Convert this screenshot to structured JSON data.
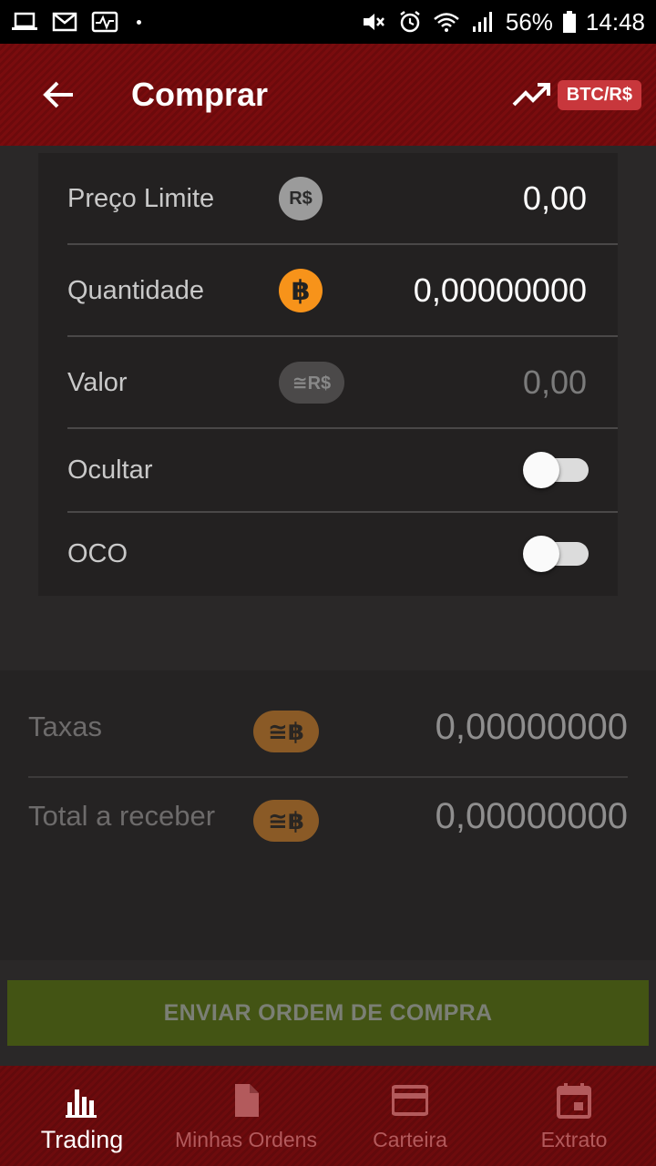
{
  "status_bar": {
    "battery": "56%",
    "time": "14:48"
  },
  "header": {
    "title": "Comprar",
    "pair": "BTC/R$"
  },
  "form": {
    "limit_price": {
      "label": "Preço Limite",
      "currency": "R$",
      "value": "0,00"
    },
    "quantity": {
      "label": "Quantidade",
      "currency": "฿",
      "value": "0,00000000"
    },
    "total_value": {
      "label": "Valor",
      "currency": "≅R$",
      "value": "0,00"
    },
    "hide": {
      "label": "Ocultar",
      "on": false
    },
    "oco": {
      "label": "OCO",
      "on": false
    }
  },
  "summary": {
    "fees": {
      "label": "Taxas",
      "currency": "≅฿",
      "value": "0,00000000"
    },
    "total": {
      "label": "Total a receber",
      "currency": "≅฿",
      "value": "0,00000000"
    }
  },
  "submit": {
    "label": "ENVIAR ORDEM DE COMPRA"
  },
  "nav": {
    "items": [
      {
        "label": "Trading",
        "icon": "bar-chart-icon",
        "active": true
      },
      {
        "label": "Minhas Ordens",
        "icon": "document-icon",
        "active": false
      },
      {
        "label": "Carteira",
        "icon": "credit-card-icon",
        "active": false
      },
      {
        "label": "Extrato",
        "icon": "calendar-icon",
        "active": false
      }
    ]
  },
  "colors": {
    "header_red": "#7a0c0e",
    "accent_red": "#c8373c",
    "bitcoin_orange": "#f7931a",
    "submit_green": "#435414"
  }
}
